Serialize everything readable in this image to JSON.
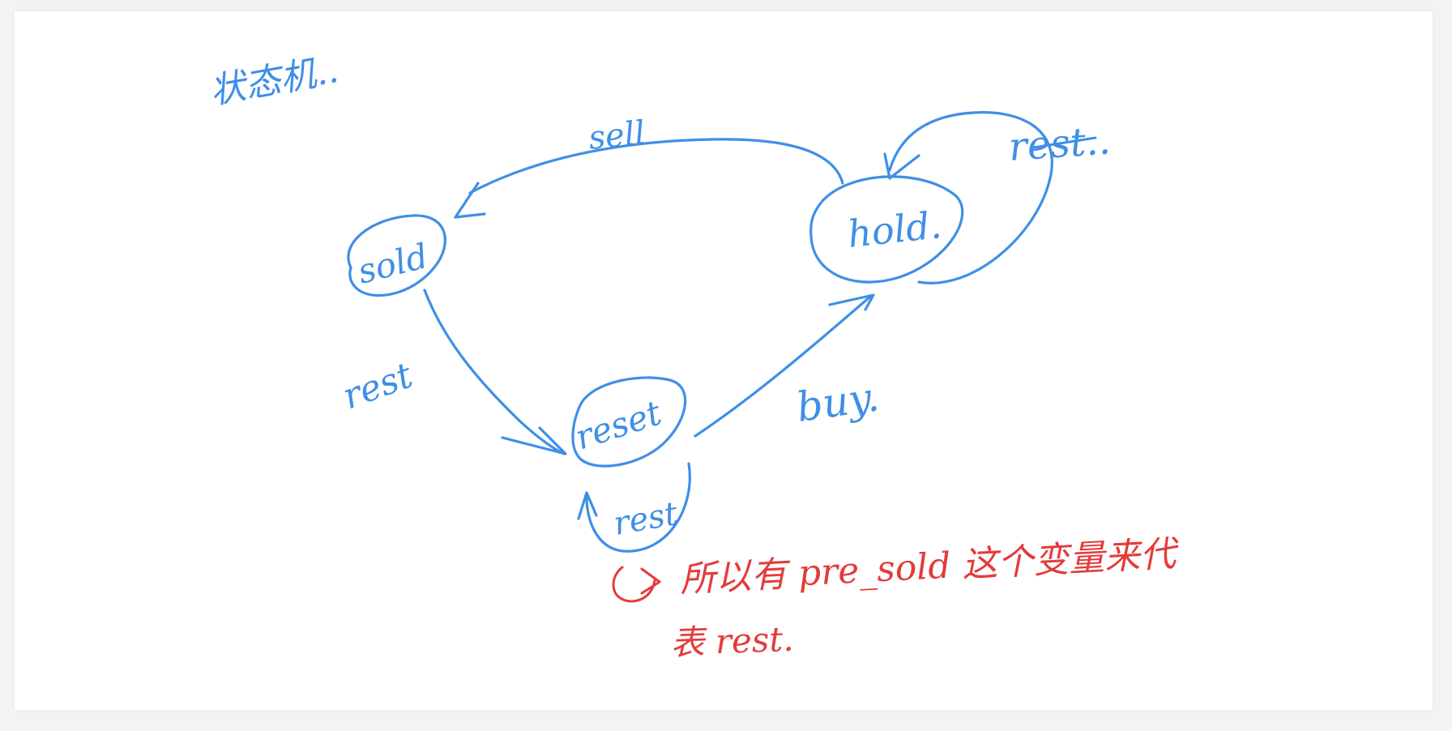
{
  "colors": {
    "blue_ink": "#3f8fe6",
    "red_ink": "#e43b3b",
    "background": "#ffffff",
    "margin": "#f3f3f1"
  },
  "diagram": {
    "title": "状态机..",
    "states": {
      "sold": "sold",
      "hold": "hold.",
      "reset": "reset"
    },
    "transitions": {
      "hold_to_sold": "sell",
      "hold_self": "rest..",
      "sold_to_reset": "rest",
      "reset_to_hold": "buy.",
      "reset_self": "rest"
    },
    "note_line1": "所以有 pre_sold 这个变量来代",
    "note_line2": "表 rest."
  }
}
